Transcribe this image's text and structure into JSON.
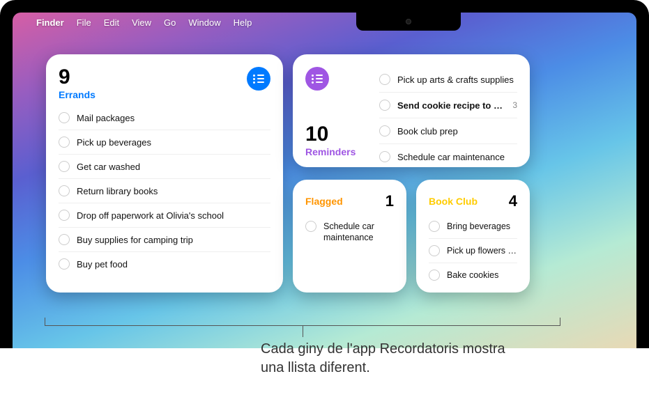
{
  "menu": {
    "app": "Finder",
    "items": [
      "File",
      "Edit",
      "View",
      "Go",
      "Window",
      "Help"
    ]
  },
  "widgets": {
    "errands": {
      "count": "9",
      "title": "Errands",
      "color": "#007aff",
      "items": [
        "Mail packages",
        "Pick up beverages",
        "Get car washed",
        "Return library books",
        "Drop off paperwork at Olivia's school",
        "Buy supplies for camping trip",
        "Buy pet food"
      ]
    },
    "reminders": {
      "count": "10",
      "title": "Reminders",
      "color": "#9f56e3",
      "items": [
        {
          "text": "Pick up arts & crafts supplies",
          "bold": false,
          "badge": ""
        },
        {
          "text": "Send cookie recipe to Rigo",
          "bold": true,
          "badge": "3"
        },
        {
          "text": "Book club prep",
          "bold": false,
          "badge": ""
        },
        {
          "text": "Schedule car maintenance",
          "bold": false,
          "badge": ""
        }
      ]
    },
    "flagged": {
      "title": "Flagged",
      "count": "1",
      "color": "#ff9500",
      "items": [
        "Schedule car maintenance"
      ]
    },
    "bookclub": {
      "title": "Book Club",
      "count": "4",
      "color": "#ffcc00",
      "items": [
        "Bring beverages",
        "Pick up flowers f…",
        "Bake cookies"
      ]
    }
  },
  "callout": {
    "text": "Cada giny de l'app Recordatoris mostra una llista diferent."
  }
}
